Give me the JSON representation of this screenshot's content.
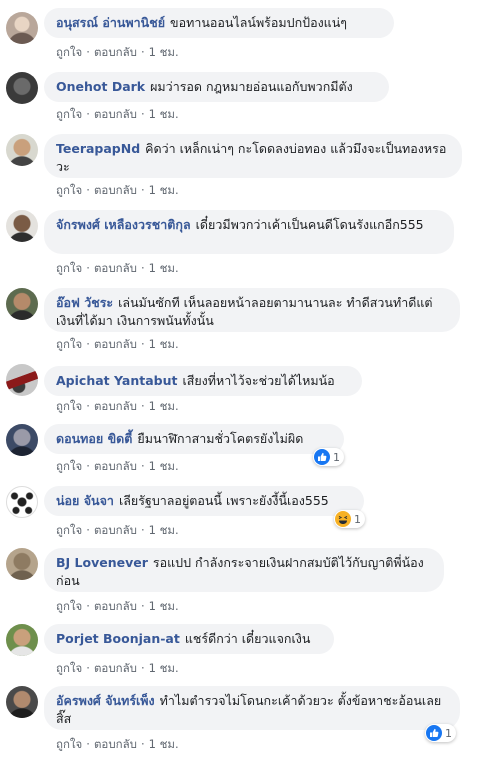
{
  "actions": {
    "like": "ถูกใจ",
    "reply": "ตอบกลับ",
    "time": "1 ชม.",
    "sep": "·"
  },
  "comments": [
    {
      "author": "อนุสรณ์ อ่านพานิชย์",
      "text": "ขอทานออนไลน์พร้อมปกป้องแน่ๆ"
    },
    {
      "author": "Onehot Dark",
      "text": "ผมว่ารอด กฎหมายอ่อนแอกับพวกมีตัง"
    },
    {
      "author": "TeerapapNd",
      "text": "คิดว่า เหล็กเน่าๆ กะโดดลงบ่อทอง แล้วมึงจะเป็นทองหรอวะ"
    },
    {
      "author": "จักรพงศ์ เหลืองวรชาติกุล",
      "text": "เดี๋ยวมีพวกว่าเค้าเป็นคนดีโดนรังแกอีก555"
    },
    {
      "author": "อ๊อฟ วัชระ",
      "text": "เล่นมันซักที เห็นลอยหน้าลอยตามานานละ ทำดีสวนทำดีแต่เงินที่ได้มา เงินการพนันทั้งนั้น"
    },
    {
      "author": "Apichat Yantabut",
      "text": "เสียงที่หาไว้จะช่วยได้ไหมน้อ"
    },
    {
      "author": "ดอนทอย ขิดตี้",
      "text": "ยืมนาฬิกาสามชั่วโคตรยังไม่ผิด",
      "reaction": {
        "type": "like",
        "count": "1"
      }
    },
    {
      "author": "น่อย จันจา",
      "text": "เลียรัฐบาลอยู่ตอนนี้ เพราะยังงี้นี้เอง555",
      "reaction": {
        "type": "haha",
        "count": "1"
      }
    },
    {
      "author": "BJ Lovenever",
      "text": "รอแปป กำลังกระจายเงินฝากสมบัติไว้กับญาติพี่น้องก่อน"
    },
    {
      "author": "Porjet Boonjan-at",
      "text": "แชร์ดีกว่า เดี๋ยวแจกเงิน"
    },
    {
      "author": "อัครพงศ์ จันทร์เพ็ง",
      "text": "ทำไมตำรวจไม่โดนกะเค้าด้วยวะ ตั้งข้อหาชะอ้อนเลยสิ๊ส",
      "reaction": {
        "type": "like",
        "count": "1"
      }
    }
  ]
}
